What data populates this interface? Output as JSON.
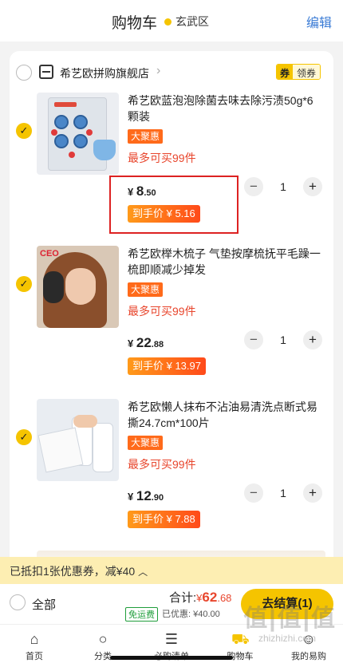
{
  "header": {
    "title": "购物车",
    "location": "玄武区",
    "edit": "编辑"
  },
  "store": {
    "name": "希艺欧拼购旗舰店",
    "coupon_tag": "券",
    "coupon_label": "领券"
  },
  "items": [
    {
      "name": "希艺欧蓝泡泡除菌去味去除污渍50g*6颗装",
      "badge": "大聚惠",
      "limit": "最多可买99件",
      "currency": "¥",
      "price_int": "8",
      "price_dec": ".50",
      "hand_price": "到手价 ¥ 5.16",
      "qty": "1"
    },
    {
      "name": "希艺欧榉木梳子 气垫按摩梳抚平毛躁一梳即顺减少掉发",
      "badge": "大聚惠",
      "limit": "最多可买99件",
      "currency": "¥",
      "price_int": "22",
      "price_dec": ".88",
      "hand_price": "到手价 ¥ 13.97",
      "qty": "1"
    },
    {
      "name": "希艺欧懒人抹布不沾油易清洗点断式易撕24.7cm*100片",
      "badge": "大聚惠",
      "limit": "最多可买99件",
      "currency": "¥",
      "price_int": "12",
      "price_dec": ".90",
      "hand_price": "到手价 ¥ 7.88",
      "qty": "1"
    }
  ],
  "stepper": {
    "minus": "−",
    "plus": "+"
  },
  "thumb2_brand": "CEO",
  "coupon_bar": {
    "text": "已抵扣1张优惠券，减¥40",
    "caret": "︿"
  },
  "footer": {
    "all": "全部",
    "total_label": "合计:",
    "total_currency": "¥",
    "total_int": "62",
    "total_dec": ".68",
    "free_shipping": "免运费",
    "saved": "已优惠: ¥40.00",
    "checkout": "去结算(1)"
  },
  "tabs": [
    {
      "label": "首页",
      "icon": "home-icon",
      "glyph": "⌂"
    },
    {
      "label": "分类",
      "icon": "search-icon",
      "glyph": "○"
    },
    {
      "label": "必购清单",
      "icon": "list-icon",
      "glyph": "☰"
    },
    {
      "label": "购物车",
      "icon": "cart-icon",
      "glyph": "⛟"
    },
    {
      "label": "我的易购",
      "icon": "user-icon",
      "glyph": "☺"
    }
  ],
  "watermark": {
    "main": "值|值|值",
    "sub": "zhizhizhi.com"
  },
  "colors": {
    "accent": "#f5c400",
    "price_red": "#e8462d",
    "badge_orange": "#ff6a1a",
    "link_blue": "#3a7bd5"
  }
}
